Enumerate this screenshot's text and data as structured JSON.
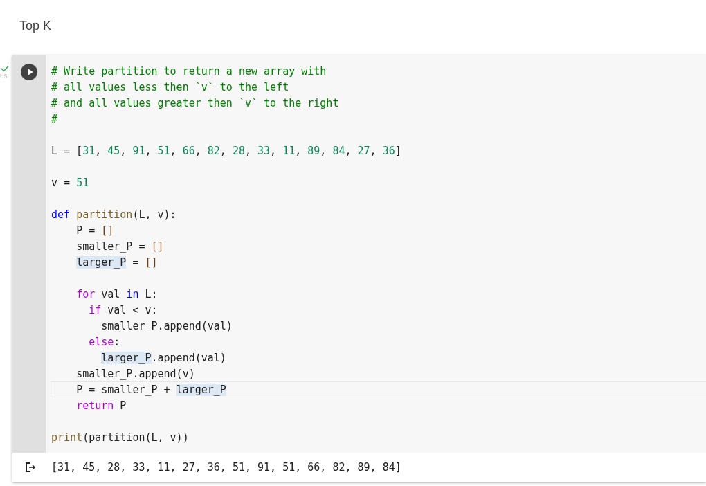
{
  "title": "Top K",
  "cell": {
    "completed": true,
    "duration": "0s",
    "code_blocks": [
      [
        {
          "current": false,
          "tokens": [
            {
              "kind": "comment",
              "text": "# Write partition to return a new array with"
            }
          ]
        },
        {
          "current": false,
          "tokens": [
            {
              "kind": "comment",
              "text": "# all values less then `v` to the left"
            }
          ]
        },
        {
          "current": false,
          "tokens": [
            {
              "kind": "comment",
              "text": "# and all values greater then `v` to the right"
            }
          ]
        },
        {
          "current": false,
          "tokens": [
            {
              "kind": "comment",
              "text": "#"
            }
          ]
        }
      ],
      [
        {
          "current": false,
          "tokens": [
            {
              "kind": "plain",
              "text": "L = ["
            },
            {
              "kind": "number",
              "text": "31"
            },
            {
              "kind": "plain",
              "text": ", "
            },
            {
              "kind": "number",
              "text": "45"
            },
            {
              "kind": "plain",
              "text": ", "
            },
            {
              "kind": "number",
              "text": "91"
            },
            {
              "kind": "plain",
              "text": ", "
            },
            {
              "kind": "number",
              "text": "51"
            },
            {
              "kind": "plain",
              "text": ", "
            },
            {
              "kind": "number",
              "text": "66"
            },
            {
              "kind": "plain",
              "text": ", "
            },
            {
              "kind": "number",
              "text": "82"
            },
            {
              "kind": "plain",
              "text": ", "
            },
            {
              "kind": "number",
              "text": "28"
            },
            {
              "kind": "plain",
              "text": ", "
            },
            {
              "kind": "number",
              "text": "33"
            },
            {
              "kind": "plain",
              "text": ", "
            },
            {
              "kind": "number",
              "text": "11"
            },
            {
              "kind": "plain",
              "text": ", "
            },
            {
              "kind": "number",
              "text": "89"
            },
            {
              "kind": "plain",
              "text": ", "
            },
            {
              "kind": "number",
              "text": "84"
            },
            {
              "kind": "plain",
              "text": ", "
            },
            {
              "kind": "number",
              "text": "27"
            },
            {
              "kind": "plain",
              "text": ", "
            },
            {
              "kind": "number",
              "text": "36"
            },
            {
              "kind": "plain",
              "text": "]"
            }
          ]
        }
      ],
      [
        {
          "current": false,
          "tokens": [
            {
              "kind": "plain",
              "text": "v = "
            },
            {
              "kind": "number",
              "text": "51"
            }
          ]
        }
      ],
      [
        {
          "current": false,
          "tokens": [
            {
              "kind": "keyword",
              "text": "def"
            },
            {
              "kind": "function",
              "text": " partition"
            },
            {
              "kind": "plain",
              "text": "(L, v):"
            }
          ]
        },
        {
          "current": false,
          "tokens": [
            {
              "kind": "plain",
              "text": "    P = "
            },
            {
              "kind": "bracket",
              "text": "[]"
            }
          ]
        },
        {
          "current": false,
          "tokens": [
            {
              "kind": "plain",
              "text": "    smaller_P = "
            },
            {
              "kind": "bracket",
              "text": "[]"
            }
          ]
        },
        {
          "current": false,
          "tokens": [
            {
              "kind": "match",
              "text": "    larger_P"
            },
            {
              "kind": "plain",
              "text": " = "
            },
            {
              "kind": "bracket",
              "text": "[]"
            }
          ]
        }
      ],
      [
        {
          "current": false,
          "tokens": [
            {
              "kind": "control",
              "text": "    for"
            },
            {
              "kind": "plain",
              "text": " val "
            },
            {
              "kind": "keyword",
              "text": "in"
            },
            {
              "kind": "plain",
              "text": " L:"
            }
          ]
        },
        {
          "current": false,
          "tokens": [
            {
              "kind": "control",
              "text": "      if"
            },
            {
              "kind": "plain",
              "text": " val < v:"
            }
          ]
        },
        {
          "current": false,
          "tokens": [
            {
              "kind": "plain",
              "text": "        smaller_P.append(val)"
            }
          ]
        },
        {
          "current": false,
          "tokens": [
            {
              "kind": "control",
              "text": "      else"
            },
            {
              "kind": "plain",
              "text": ":"
            }
          ]
        },
        {
          "current": false,
          "tokens": [
            {
              "kind": "match",
              "text": "        larger_P"
            },
            {
              "kind": "plain",
              "text": ".append(val)"
            }
          ]
        },
        {
          "current": false,
          "tokens": [
            {
              "kind": "plain",
              "text": "    smaller_P.append(v)"
            }
          ]
        },
        {
          "current": true,
          "tokens": [
            {
              "kind": "plain",
              "text": "    P = smaller_P + "
            },
            {
              "kind": "match",
              "text": "larger_P"
            }
          ]
        },
        {
          "current": false,
          "tokens": [
            {
              "kind": "control",
              "text": "    return"
            },
            {
              "kind": "plain",
              "text": " P"
            }
          ]
        }
      ],
      [
        {
          "current": false,
          "tokens": [
            {
              "kind": "function",
              "text": "print"
            },
            {
              "kind": "plain",
              "text": "(partition(L, v))"
            }
          ]
        }
      ]
    ],
    "output": "[31, 45, 28, 33, 11, 27, 36, 51, 91, 51, 66, 82, 89, 84]"
  }
}
